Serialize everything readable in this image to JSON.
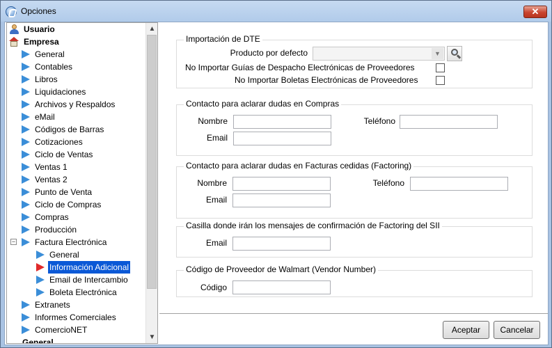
{
  "window": {
    "title": "Opciones",
    "close_label": "✕"
  },
  "tree": {
    "items": [
      {
        "label": "Usuario",
        "bold": true,
        "icon": "user-icon"
      },
      {
        "label": "Empresa",
        "bold": true,
        "icon": "house-icon"
      },
      {
        "label": "General",
        "icon": "arrow-icon"
      },
      {
        "label": "Contables",
        "icon": "arrow-icon"
      },
      {
        "label": "Libros",
        "icon": "arrow-icon"
      },
      {
        "label": "Liquidaciones",
        "icon": "arrow-icon"
      },
      {
        "label": "Archivos y Respaldos",
        "icon": "arrow-icon"
      },
      {
        "label": "eMail",
        "icon": "arrow-icon"
      },
      {
        "label": "Códigos de Barras",
        "icon": "arrow-icon"
      },
      {
        "label": "Cotizaciones",
        "icon": "arrow-icon"
      },
      {
        "label": "Ciclo de Ventas",
        "icon": "arrow-icon"
      },
      {
        "label": "Ventas 1",
        "icon": "arrow-icon"
      },
      {
        "label": "Ventas 2",
        "icon": "arrow-icon"
      },
      {
        "label": "Punto de Venta",
        "icon": "arrow-icon"
      },
      {
        "label": "Ciclo de Compras",
        "icon": "arrow-icon"
      },
      {
        "label": "Compras",
        "icon": "arrow-icon"
      },
      {
        "label": "Producción",
        "icon": "arrow-icon"
      },
      {
        "label": "Factura Electrónica",
        "icon": "arrow-icon",
        "expander": "−"
      },
      {
        "label": "General",
        "icon": "arrow-icon"
      },
      {
        "label": "Información Adicional",
        "icon": "arrow-icon-red",
        "selected": true
      },
      {
        "label": "Email de Intercambio",
        "icon": "arrow-icon"
      },
      {
        "label": "Boleta Electrónica",
        "icon": "arrow-icon"
      },
      {
        "label": "Extranets",
        "icon": "arrow-icon"
      },
      {
        "label": "Informes Comerciales",
        "icon": "arrow-icon"
      },
      {
        "label": "ComercioNET",
        "icon": "arrow-icon"
      },
      {
        "label": "General",
        "bold": true,
        "icon": "none"
      }
    ]
  },
  "dte": {
    "group_title": "Importación de DTE",
    "producto_label": "Producto por defecto",
    "producto_value": "",
    "guias_label": "No Importar Guías de Despacho Electrónicas de Proveedores",
    "guias_checked": false,
    "boletas_label": "No Importar Boletas Electrónicas de Proveedores",
    "boletas_checked": false
  },
  "compras": {
    "group_title": "Contacto para aclarar dudas en Compras",
    "nombre_label": "Nombre",
    "nombre_value": "",
    "telefono_label": "Teléfono",
    "telefono_value": "",
    "email_label": "Email",
    "email_value": ""
  },
  "factoring": {
    "group_title": "Contacto para aclarar dudas en Facturas cedidas (Factoring)",
    "nombre_label": "Nombre",
    "nombre_value": "",
    "telefono_label": "Teléfono",
    "telefono_value": "",
    "email_label": "Email",
    "email_value": ""
  },
  "casilla": {
    "group_title": "Casilla donde irán los mensajes de confirmación de Factoring del SII",
    "email_label": "Email",
    "email_value": ""
  },
  "walmart": {
    "group_title": "Código de Proveedor de Walmart (Vendor Number)",
    "codigo_label": "Código",
    "codigo_value": ""
  },
  "buttons": {
    "aceptar": "Aceptar",
    "cancelar": "Cancelar"
  }
}
